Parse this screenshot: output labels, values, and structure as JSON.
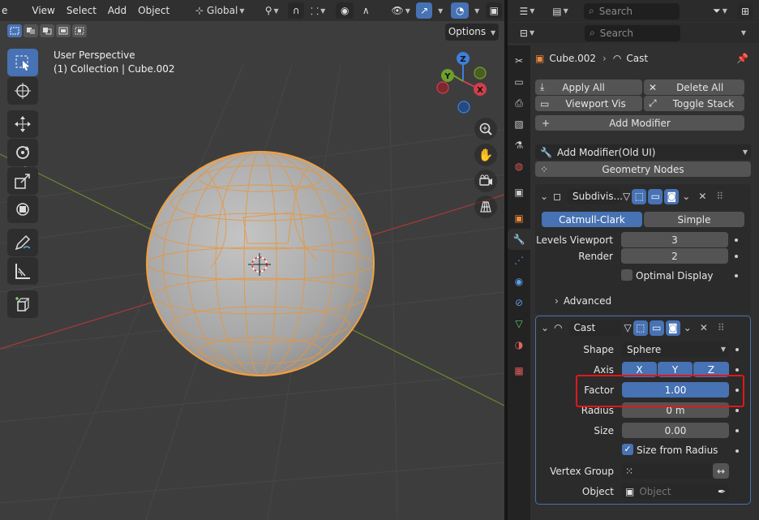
{
  "viewport": {
    "header": {
      "editor_partial": "e",
      "menus": [
        "View",
        "Select",
        "Add",
        "Object"
      ],
      "orientation": "Global"
    },
    "options_label": "Options",
    "perspective": "User Perspective",
    "collection_line": "(1) Collection | Cube.002",
    "gizmo_axes": {
      "z": "Z",
      "y": "Y",
      "x": "X"
    },
    "tools": [
      "select-box",
      "cursor",
      "move",
      "rotate",
      "scale",
      "transform",
      "annotate",
      "measure",
      "add-cube"
    ]
  },
  "outliner": {
    "search_placeholder": "Search"
  },
  "properties": {
    "search_placeholder": "Search",
    "breadcrumb": {
      "object": "Cube.002",
      "modifier": "Cast"
    },
    "apply_all": "Apply All",
    "delete_all": "Delete All",
    "viewport_vis": "Viewport Vis",
    "toggle_stack": "Toggle Stack",
    "add_modifier": "Add Modifier",
    "add_modifier_old": "Add Modifier(Old UI)",
    "geometry_nodes": "Geometry Nodes",
    "subdivision": {
      "name": "Subdivis...",
      "catmull_clark": "Catmull-Clark",
      "simple": "Simple",
      "levels_viewport_label": "Levels Viewport",
      "levels_viewport_value": "3",
      "render_label": "Render",
      "render_value": "2",
      "optimal_display": "Optimal Display",
      "advanced": "Advanced"
    },
    "cast": {
      "name": "Cast",
      "shape_label": "Shape",
      "shape_value": "Sphere",
      "axis_label": "Axis",
      "axis_x": "X",
      "axis_y": "Y",
      "axis_z": "Z",
      "factor_label": "Factor",
      "factor_value": "1.00",
      "radius_label": "Radius",
      "radius_value": "0 m",
      "size_label": "Size",
      "size_value": "0.00",
      "size_from_radius": "Size from Radius",
      "vertex_group_label": "Vertex Group",
      "object_label": "Object",
      "object_placeholder": "Object"
    }
  },
  "colors": {
    "accent": "#4772b3",
    "highlight": "#e01818",
    "wire": "#f0a040"
  }
}
